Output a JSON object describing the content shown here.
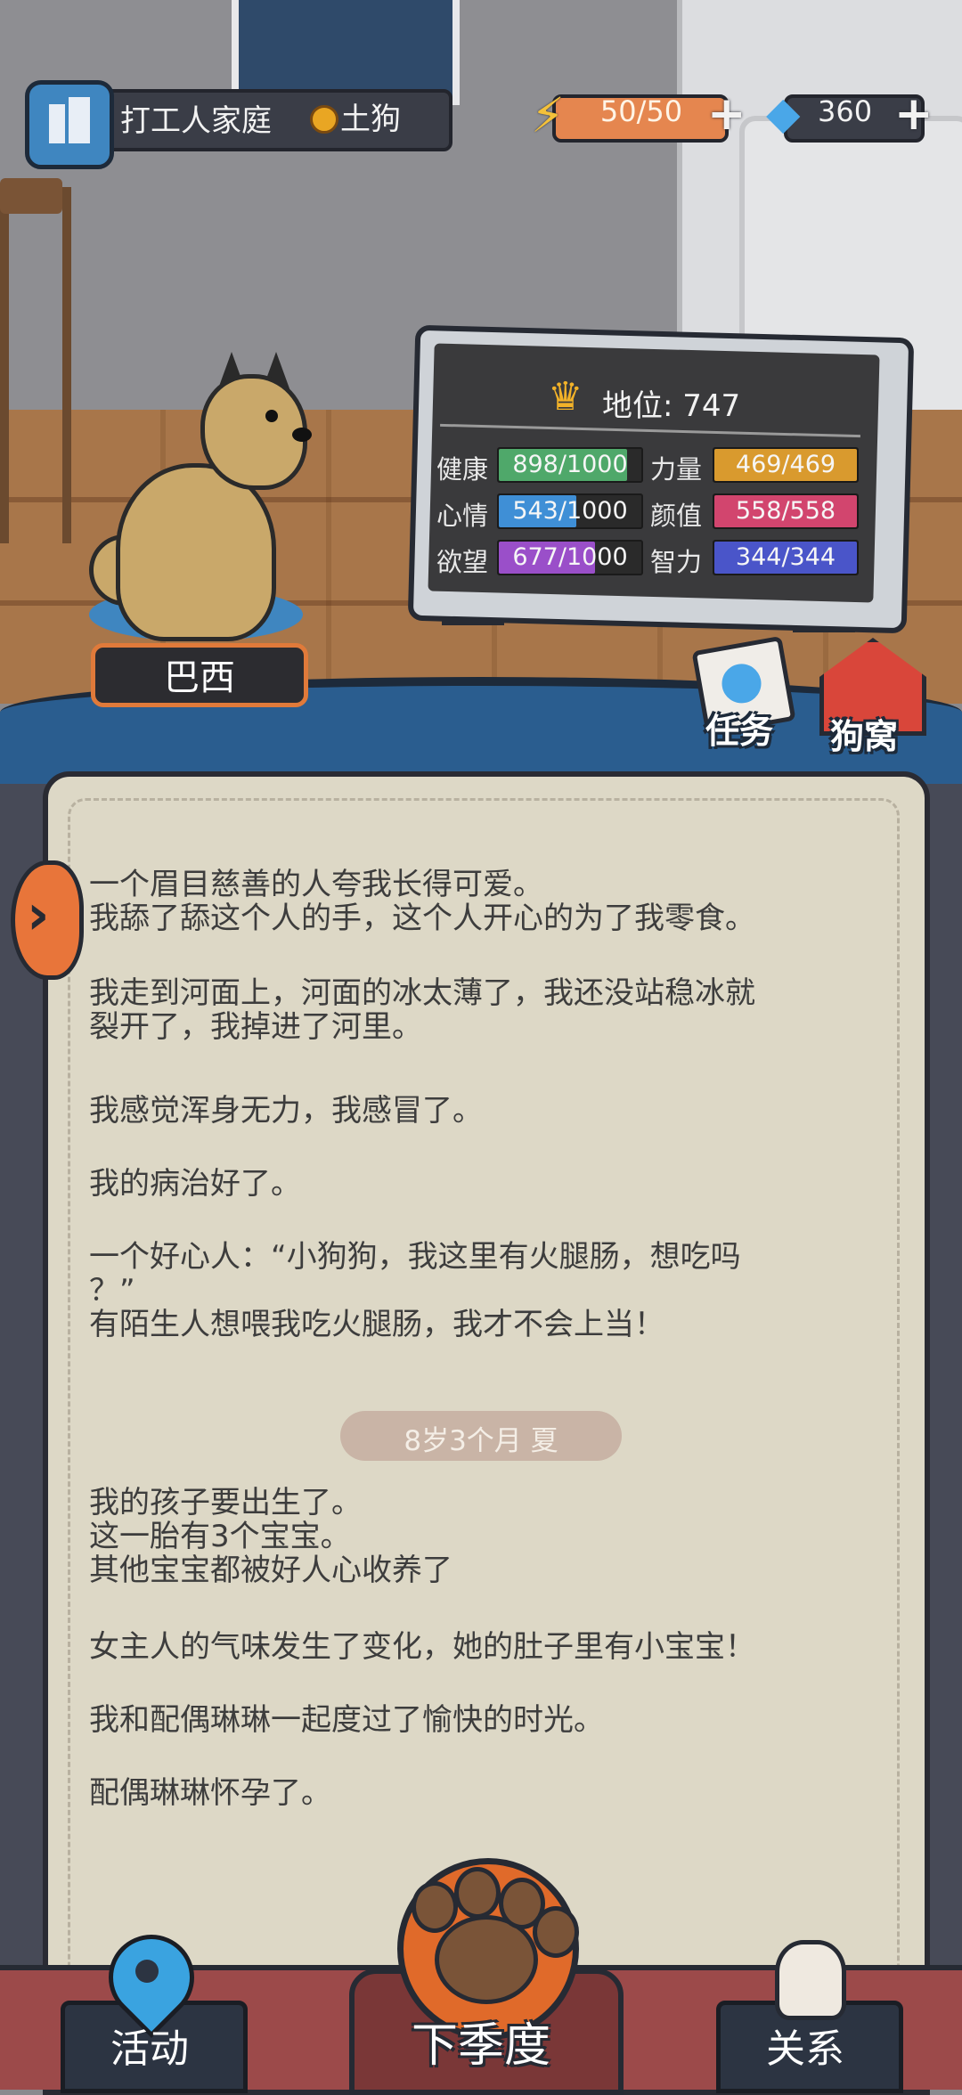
{
  "header": {
    "family": "打工人家庭",
    "rank": "土狗",
    "energy": "50/50",
    "gems": "360",
    "plus": "+",
    "energy_icon": "lightning-bolt-icon",
    "gem_icon": "diamond-icon"
  },
  "dog": {
    "name": "巴西"
  },
  "status": {
    "title": "地位: 747",
    "stats": [
      {
        "label": "健康",
        "value": "898/1000",
        "level": 0.898,
        "color": "#4fa86a"
      },
      {
        "label": "心情",
        "value": "543/1000",
        "level": 0.543,
        "color": "#3f8fd6"
      },
      {
        "label": "欲望",
        "value": "677/1000",
        "level": 0.677,
        "color": "#9a4fc9"
      },
      {
        "label": "力量",
        "value": "469/469",
        "level": 1.0,
        "color": "#d99a2e"
      },
      {
        "label": "颜值",
        "value": "558/558",
        "level": 1.0,
        "color": "#d2456e"
      },
      {
        "label": "智力",
        "value": "344/344",
        "level": 1.0,
        "color": "#4a55c9"
      }
    ]
  },
  "actions": {
    "task": "任务",
    "kennel": "狗窝"
  },
  "log": {
    "entries_top": [
      "一个眉目慈善的人夸我长得可爱。\n我舔了舔这个人的手，这个人开心的为了我零食。",
      "我走到河面上，河面的冰太薄了，我还没站稳冰就\n裂开了，我掉进了河里。",
      "我感觉浑身无力，我感冒了。",
      "我的病治好了。",
      "一个好心人：“小狗狗，我这里有火腿肠，想吃吗\n？”\n有陌生人想喂我吃火腿肠，我才不会上当！"
    ],
    "age": "8岁3个月 夏",
    "entries_bottom": [
      "我的孩子要出生了。\n这一胎有3个宝宝。\n其他宝宝都被好人心收养了",
      "女主人的气味发生了变化，她的肚子里有小宝宝！",
      "我和配偶琳琳一起度过了愉快的时光。",
      "配偶琳琳怀孕了。"
    ]
  },
  "nav": {
    "activity": "活动",
    "next_season": "下季度",
    "relation": "关系"
  }
}
